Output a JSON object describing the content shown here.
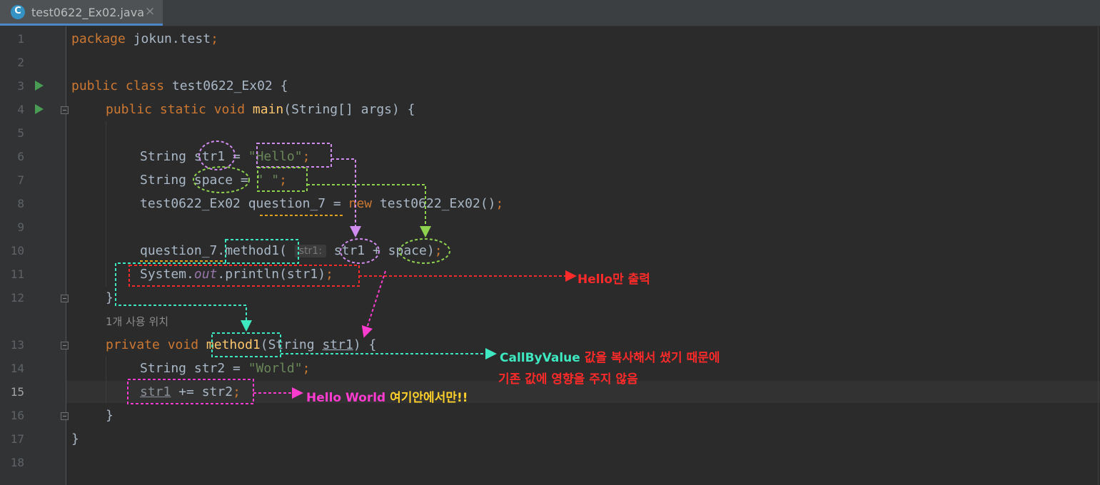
{
  "editor_tab": {
    "title": "test0622_Ex02.java",
    "close": "×"
  },
  "line_numbers": [
    "1",
    "2",
    "3",
    "4",
    "5",
    "6",
    "7",
    "8",
    "9",
    "10",
    "11",
    "12",
    "13",
    "14",
    "15",
    "16",
    "17",
    "18"
  ],
  "code": {
    "l1": {
      "kw": "package",
      "rest": " jokun.test",
      "semi": ";"
    },
    "l3": {
      "kw": "public class",
      "rest": " test0622_Ex02 {"
    },
    "l4": {
      "kw": "public static void",
      "fn": "main",
      "rest": "(String[] args) {"
    },
    "l6": {
      "type": "String ",
      "var": "str1",
      "eq": " = ",
      "value": "\"Hello\"",
      "semi": ";"
    },
    "l7": {
      "type": "String ",
      "var": "space",
      "eq": " = ",
      "value": "\" \"",
      "semi": ";"
    },
    "l8": {
      "type": "test0622_Ex02 ",
      "var": "question_7",
      "eq": " = ",
      "kw": "new",
      "rest": " test0622_Ex02()",
      "semi": ";"
    },
    "l10": {
      "obj": "question_7",
      "call": ".method1(",
      "hint": "str1:",
      "arg1": "str1",
      "plus": " + ",
      "arg2": "space",
      "close": ")",
      "semi": ";"
    },
    "l11": {
      "cls": "System.",
      "field": "out",
      "rest": ".println(str1)",
      "semi": ";"
    },
    "l12": {
      "brace": "}"
    },
    "usage_hint": "1개 사용 위치",
    "l13": {
      "kw": "private void",
      "fn": "method1",
      "params_open": "(String ",
      "param": "str1",
      "params_close": ") {"
    },
    "l14": {
      "type": "String str2 = ",
      "value": "\"World\"",
      "semi": ";"
    },
    "l15": {
      "var": "str1",
      "rest": " += str2",
      "semi": ";"
    },
    "l16": {
      "brace": "}"
    },
    "l17": {
      "brace": "}"
    }
  },
  "annotations": {
    "hello_only": "Hello만 출력",
    "callbyvalue_title": "CallByValue",
    "callbyvalue_line1": " 값을 복사해서 썼기 때문에",
    "callbyvalue_line2": "기존 값에 영향을 주지 않음",
    "hello_world": "Hello World",
    "only_here": " 여기안에서만!!"
  },
  "colors": {
    "purple": "#d18cf0",
    "green": "#8fd24f",
    "cyan": "#3ee8c0",
    "red": "#ff2a2a",
    "magenta": "#ff3cd0",
    "yellow": "#ffd02a"
  }
}
